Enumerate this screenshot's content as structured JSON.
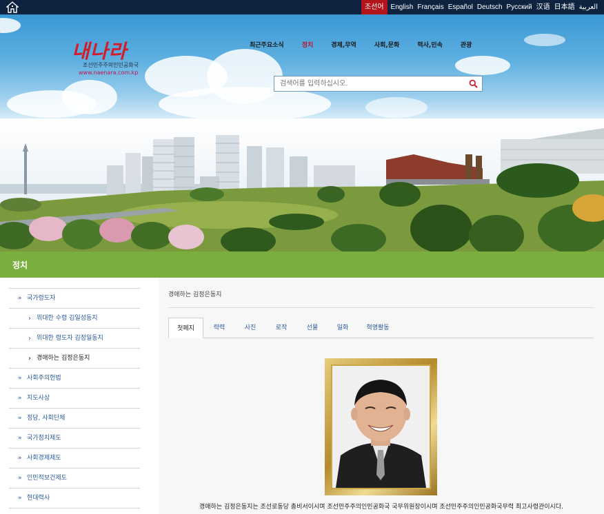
{
  "top_bar": {
    "home_icon": "home-icon",
    "languages": [
      "조선어",
      "English",
      "Français",
      "Español",
      "Deutsch",
      "Русский",
      "汉语",
      "日本語",
      "العربية"
    ],
    "active_language": "조선어"
  },
  "logo": {
    "script": "내나라",
    "subtitle": "조선민주주의인민공화국",
    "url": "www.naenara.com.kp"
  },
  "nav": {
    "items": [
      "최근주요소식",
      "정치",
      "경제,무역",
      "사회,문화",
      "력사,민속",
      "관광"
    ],
    "active": "정치"
  },
  "search": {
    "placeholder": "검색어를 입력하십시오.",
    "icon": "search-icon"
  },
  "section": {
    "title": "정치"
  },
  "sidebar": {
    "items": [
      {
        "label": "국가령도자",
        "level": 1
      },
      {
        "label": "위대한 수령 김일성동지",
        "level": 2
      },
      {
        "label": "위대한 령도자 김정일동지",
        "level": 2
      },
      {
        "label": "경애하는 김정은동지",
        "level": 2,
        "current": true
      },
      {
        "label": "사회주의헌법",
        "level": 1
      },
      {
        "label": "지도사상",
        "level": 1
      },
      {
        "label": "정당, 사회단체",
        "level": 1
      },
      {
        "label": "국가정치제도",
        "level": 1
      },
      {
        "label": "사회경제제도",
        "level": 1
      },
      {
        "label": "인민적보건제도",
        "level": 1
      },
      {
        "label": "현대력사",
        "level": 1
      }
    ]
  },
  "main": {
    "breadcrumb": "경애하는 김정은동지",
    "tabs": [
      "첫페지",
      "략력",
      "사진",
      "로작",
      "선물",
      "일화",
      "혁명활동"
    ],
    "active_tab": "첫페지",
    "caption": "경애하는 김정은동지는 조선로동당 총비서이시며 조선민주주의인민공화국 국무위원장이시며 조선민주주의인민공화국무력 최고사령관이시다."
  },
  "colors": {
    "top_bar": "#0d2340",
    "active_language": "#b3141c",
    "section_bar": "#7aae3e",
    "link": "#2a5a9a",
    "nav_active": "#c0143c"
  }
}
